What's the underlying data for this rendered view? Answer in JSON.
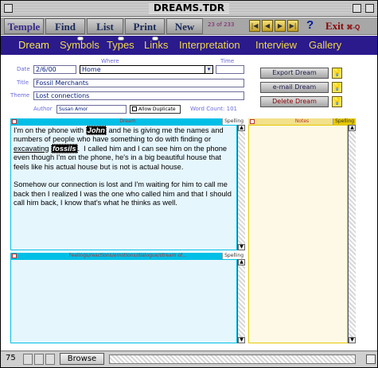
{
  "window": {
    "title": "DREAMS.TDR"
  },
  "toolbar": {
    "temple": "Temple",
    "find": "Find",
    "list": "List",
    "print": "Print",
    "new": "New",
    "record_count": "23 of 233",
    "help": "?",
    "exit": "Exit",
    "exit_key": "⌘-Q"
  },
  "tabs": [
    "Dream",
    "Symbols",
    "Types",
    "Links",
    "Interpretation",
    "Interview",
    "Gallery"
  ],
  "form": {
    "date_label": "Date",
    "date_value": "2/6/00",
    "where_label": "Where",
    "where_value": "Home",
    "time_label": "Time",
    "time_value": "",
    "title_label": "Title",
    "title_value": "Fossil Merchants",
    "theme_label": "Theme",
    "theme_value": "Lost connections",
    "author_label": "Author",
    "author_value": "Susan Amor",
    "allow_duplicate": "Allow Duplicate",
    "word_count_label": "Word Count:",
    "word_count_value": "101"
  },
  "actions": {
    "export": "Export Dream",
    "email": "e-mail Dream",
    "delete": "Delete Dream"
  },
  "dream_panel": {
    "header": "Dream",
    "spelling": "Spelling",
    "line1a": "I'm on the phone with ",
    "john": "John",
    "line1b": " and he is giving me the names and",
    "line2": "numbers of people who have something to do with finding or",
    "excavating": "excavating",
    "fossils": "fossils",
    "line3b": ".  I called him and I can see him on the phone",
    "line4": "even though I'm on the phone, he's in a big beautiful house that",
    "line5": "feels like his actual house but is not is actual house.",
    "para2": "Somehow our connection is lost and I'm waiting for him to call me back then I realized I was the one who called him and that I should call him back, I know that's what he thinks as well."
  },
  "feelings_panel": {
    "header": "Feelings/reactions/emotions/dialogue/stream of...",
    "spelling": "Spelling"
  },
  "notes_panel": {
    "header": "Notes",
    "spelling": "Spelling"
  },
  "status": {
    "zoom": "75",
    "mode": "Browse"
  },
  "colors": {
    "tab_bg": "#2a1a8c",
    "tab_text": "#f0d84a",
    "dream_bg": "#e6f6fd",
    "notes_bg": "#fdf9e6",
    "panel_border": "#00bfe6",
    "notes_border": "#e6c800"
  }
}
